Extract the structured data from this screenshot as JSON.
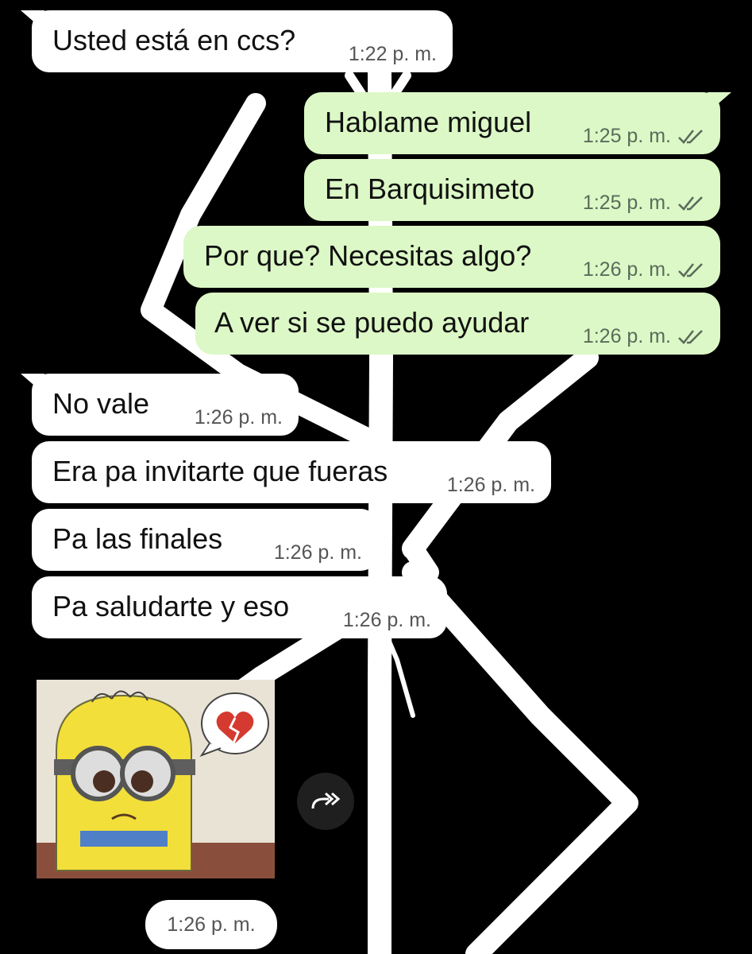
{
  "wallpaper": {
    "description_icon": "white-stick-figure-wallpaper"
  },
  "messages": [
    {
      "text": "Usted está en ccs?",
      "time": "1:22 p. m."
    },
    {
      "text": "Hablame miguel",
      "time": "1:25 p. m."
    },
    {
      "text": "En Barquisimeto",
      "time": "1:25 p. m."
    },
    {
      "text": "Por que? Necesitas algo?",
      "time": "1:26 p. m."
    },
    {
      "text": "A ver si se puedo ayudar",
      "time": "1:26 p. m."
    },
    {
      "text": "No vale",
      "time": "1:26 p. m."
    },
    {
      "text": "Era pa invitarte que fueras",
      "time": "1:26 p. m."
    },
    {
      "text": "Pa las finales",
      "time": "1:26 p. m."
    },
    {
      "text": "Pa saludarte y eso",
      "time": "1:26 p. m."
    }
  ],
  "sticker": {
    "icon": "sad-minion-broken-heart-sticker",
    "time": "1:26 p. m."
  },
  "forward": {
    "icon": "forward-icon"
  },
  "colors": {
    "incoming": "#ffffff",
    "outgoing": "#dcf8c6",
    "background": "#000000"
  }
}
